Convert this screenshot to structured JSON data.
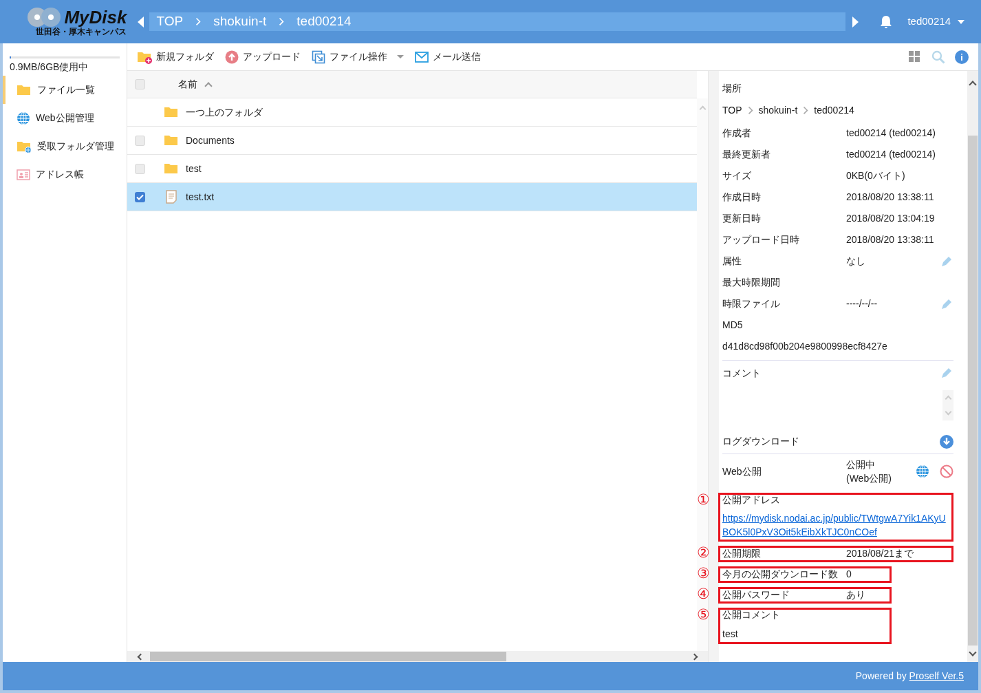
{
  "header": {
    "logo_title": "MyDisk",
    "logo_subtitle": "世田谷・厚木キャンパス",
    "breadcrumb": [
      "TOP",
      "shokuin-t",
      "ted00214"
    ],
    "user": "ted00214"
  },
  "sidebar": {
    "usage": {
      "text": "0.9MB/6GB使用中",
      "level": 0.01
    },
    "items": [
      {
        "label": "ファイル一覧",
        "kind": "folder",
        "selected": true
      },
      {
        "label": "Web公開管理",
        "kind": "web",
        "selected": false
      },
      {
        "label": "受取フォルダ管理",
        "kind": "inbox",
        "selected": false
      },
      {
        "label": "アドレス帳",
        "kind": "contacts",
        "selected": false
      }
    ]
  },
  "toolbar": [
    {
      "label": "新規フォルダ",
      "kind": "new-folder",
      "dropdown": false
    },
    {
      "label": "アップロード",
      "kind": "upload",
      "dropdown": false
    },
    {
      "label": "ファイル操作",
      "kind": "operation",
      "dropdown": true
    },
    {
      "label": "メール送信",
      "kind": "mail",
      "dropdown": false
    }
  ],
  "file_list": {
    "column": "名前",
    "all_checked": false,
    "rows": [
      {
        "name": "一つ上のフォルダ",
        "kind": "up",
        "selected": false
      },
      {
        "name": "Documents",
        "kind": "folder",
        "selected": false
      },
      {
        "name": "test",
        "kind": "folder",
        "selected": false
      },
      {
        "name": "test.txt",
        "kind": "file",
        "selected": true
      }
    ]
  },
  "details": {
    "location_label": "場所",
    "location": [
      "TOP",
      "shokuin-t",
      "ted00214"
    ],
    "rows": [
      {
        "kind": "pair",
        "label": "作成者",
        "value": "ted00214 (ted00214)",
        "editable": false
      },
      {
        "kind": "pair",
        "label": "最終更新者",
        "value": "ted00214 (ted00214)",
        "editable": false
      },
      {
        "kind": "pair",
        "label": "サイズ",
        "value": "0KB(0バイト)",
        "editable": false
      },
      {
        "kind": "pair",
        "label": "作成日時",
        "value": "2018/08/20 13:38:11",
        "editable": false
      },
      {
        "kind": "pair",
        "label": "更新日時",
        "value": "2018/08/20 13:04:19",
        "editable": false
      },
      {
        "kind": "pair",
        "label": "アップロード日時",
        "value": "2018/08/20 13:38:11",
        "editable": false
      },
      {
        "kind": "pair",
        "label": "属性",
        "value": "なし",
        "editable": true
      },
      {
        "kind": "pair",
        "label": "最大時限期間",
        "editable": false
      },
      {
        "kind": "pair",
        "label": "時限ファイル",
        "value": "----/--/--",
        "editable": true
      },
      {
        "kind": "pair",
        "label": "MD5",
        "editable": false
      },
      {
        "kind": "text",
        "value": "d41d8cd98f00b204e9800998ecf8427e"
      }
    ],
    "comment_label": "コメント",
    "log_label": "ログダウンロード",
    "web_label": "Web公開",
    "web_status": "公開中\n(Web公開)",
    "public": [
      {
        "marker": "①",
        "kind": "link",
        "label": "公開アドレス",
        "value": "https://mydisk.nodai.ac.jp/public/TWtgwA7Yik1AKyUBOK5l0PxV3Oit5kEibXkTJC0nCOef"
      },
      {
        "marker": "②",
        "kind": "pair",
        "label": "公開期限",
        "value": "2018/08/21まで"
      },
      {
        "marker": "③",
        "kind": "pair",
        "label": "今月の公開ダウンロード数",
        "value": "0"
      },
      {
        "marker": "④",
        "kind": "pair",
        "label": "公開パスワード",
        "value": "あり"
      },
      {
        "marker": "⑤",
        "kind": "block",
        "label": "公開コメント",
        "value": "test"
      }
    ]
  },
  "footer": {
    "prefix": "Powered by ",
    "link": "Proself Ver.5"
  }
}
